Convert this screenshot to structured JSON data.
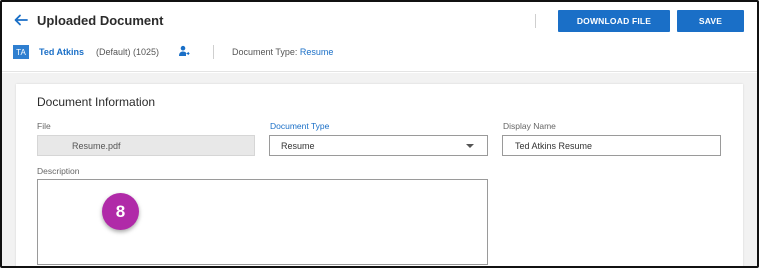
{
  "header": {
    "title": "Uploaded Document",
    "download_label": "DOWNLOAD FILE",
    "save_label": "SAVE"
  },
  "employee": {
    "initials": "TA",
    "name": "Ted Atkins",
    "meta": "(Default) (1025)",
    "doc_type_label": "Document Type: ",
    "doc_type_value": "Resume"
  },
  "form": {
    "section_title": "Document Information",
    "file_label": "File",
    "file_value": "Resume.pdf",
    "doc_type_label": "Document Type",
    "doc_type_value": "Resume",
    "display_name_label": "Display Name",
    "display_name_value": "Ted Atkins Resume",
    "description_label": "Description",
    "description_value": ""
  },
  "step_badge": "8",
  "colors": {
    "accent": "#1a6fc7",
    "badge": "#b02aa8"
  },
  "icons": {
    "back": "arrow-left-icon",
    "person": "person-link-icon",
    "caret": "chevron-down-icon"
  }
}
